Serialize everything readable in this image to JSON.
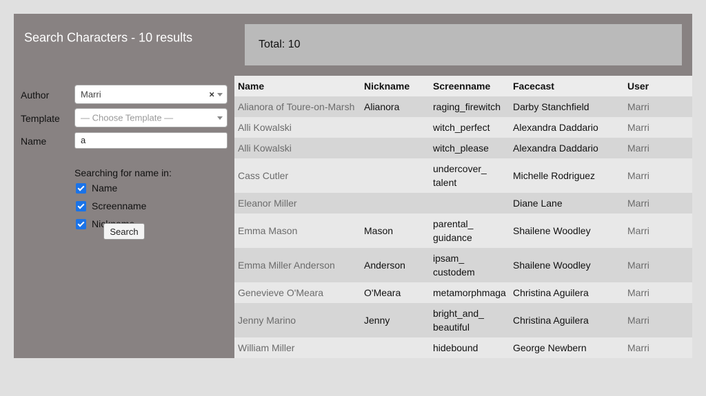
{
  "header": {
    "title": "Search Characters - 10 results"
  },
  "total": {
    "text": "Total: 10"
  },
  "form": {
    "author": {
      "label": "Author",
      "value": "Marri",
      "clear": "×"
    },
    "template": {
      "label": "Template",
      "placeholder": "— Choose Template —"
    },
    "name": {
      "label": "Name",
      "value": "a"
    },
    "search_in_label": "Searching for name in:",
    "checks": [
      {
        "label": "Name",
        "checked": true
      },
      {
        "label": "Screenname",
        "checked": true
      },
      {
        "label": "Nickname",
        "checked": true
      }
    ],
    "search_button": "Search"
  },
  "table": {
    "headers": [
      "Name",
      "Nickname",
      "Screenname",
      "Facecast",
      "User"
    ],
    "rows": [
      {
        "name": "Alianora of Toure-on-Marsh",
        "nickname": "Alianora",
        "screenname": "raging_firewitch",
        "facecast": "Darby Stanchfield",
        "user": "Marri"
      },
      {
        "name": "Alli Kowalski",
        "nickname": "",
        "screenname": "witch_perfect",
        "facecast": "Alexandra Daddario",
        "user": "Marri"
      },
      {
        "name": "Alli Kowalski",
        "nickname": "",
        "screenname": "witch_please",
        "facecast": "Alexandra Daddario",
        "user": "Marri"
      },
      {
        "name": "Cass Cutler",
        "nickname": "",
        "screenname": "undercover_ talent",
        "facecast": "Michelle Rodriguez",
        "user": "Marri"
      },
      {
        "name": "Eleanor Miller",
        "nickname": "",
        "screenname": "",
        "facecast": "Diane Lane",
        "user": "Marri"
      },
      {
        "name": "Emma Mason",
        "nickname": "Mason",
        "screenname": "parental_ guidance",
        "facecast": "Shailene Woodley",
        "user": "Marri"
      },
      {
        "name": "Emma Miller Anderson",
        "nickname": "Anderson",
        "screenname": "ipsam_ custodem",
        "facecast": "Shailene Woodley",
        "user": "Marri"
      },
      {
        "name": "Genevieve O'Meara",
        "nickname": "O'Meara",
        "screenname": "metamorphmaga",
        "facecast": "Christina Aguilera",
        "user": "Marri"
      },
      {
        "name": "Jenny Marino",
        "nickname": "Jenny",
        "screenname": "bright_and_ beautiful",
        "facecast": "Christina Aguilera",
        "user": "Marri"
      },
      {
        "name": "William Miller",
        "nickname": "",
        "screenname": "hidebound",
        "facecast": "George Newbern",
        "user": "Marri"
      }
    ]
  }
}
